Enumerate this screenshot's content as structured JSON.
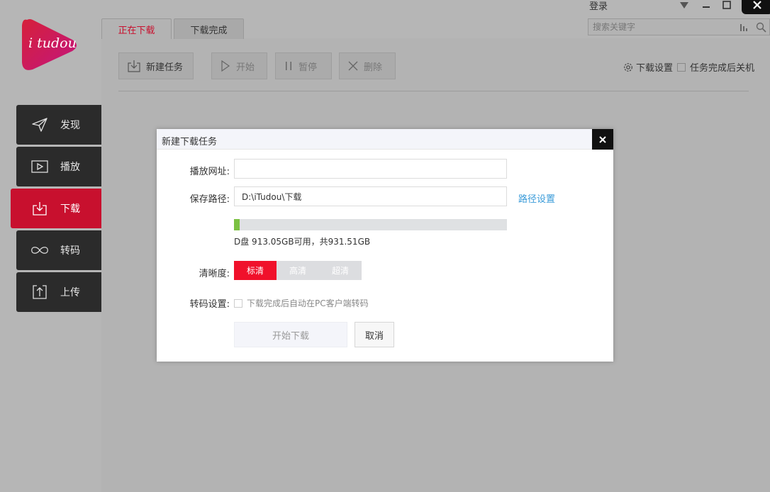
{
  "brand": {
    "logo_text": "i tudou",
    "accent": "#c8102e"
  },
  "sidebar": {
    "items": [
      {
        "label": "发现",
        "icon": "send-icon"
      },
      {
        "label": "播放",
        "icon": "play-icon"
      },
      {
        "label": "下载",
        "icon": "download-icon",
        "active": true
      },
      {
        "label": "转码",
        "icon": "infinity-icon"
      },
      {
        "label": "上传",
        "icon": "upload-icon"
      }
    ]
  },
  "titlebar": {
    "login_label": "登录"
  },
  "search": {
    "placeholder": "搜索关键字"
  },
  "tabs": [
    {
      "label": "正在下载",
      "active": true
    },
    {
      "label": "下载完成"
    }
  ],
  "toolbar": {
    "new_task_label": "新建任务",
    "start_label": "开始",
    "pause_label": "暂停",
    "delete_label": "删除",
    "download_settings_label": "下载设置",
    "shutdown_label": "任务完成后关机"
  },
  "dialog": {
    "title": "新建下载任务",
    "url_label": "播放网址:",
    "url_value": "",
    "path_label": "保存路径:",
    "path_value": "D:\\iTudou\\下载",
    "path_settings_link": "路径设置",
    "disk": {
      "text": "D盘 913.05GB可用，共931.51GB",
      "used_fraction": 0.02
    },
    "quality_label": "清晰度:",
    "quality_options": [
      "标清",
      "高清",
      "超清"
    ],
    "quality_selected": "标清",
    "transcode_label": "转码设置:",
    "transcode_checkbox_label": "下载完成后自动在PC客户端转码",
    "start_button": "开始下载",
    "cancel_button": "取消"
  }
}
